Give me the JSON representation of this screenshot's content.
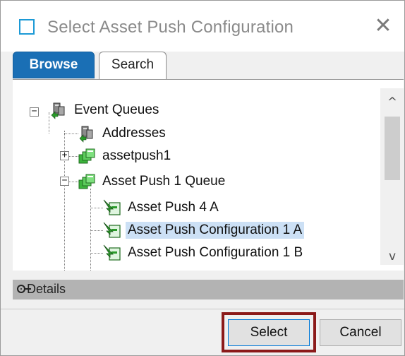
{
  "dialog": {
    "title": "Select Asset Push Configuration",
    "close_glyph": "✕"
  },
  "tabs": [
    {
      "label": "Browse",
      "active": true
    },
    {
      "label": "Search",
      "active": false
    }
  ],
  "tree": {
    "nodes": [
      {
        "label": "Event Queues",
        "icon": "event-queue-icon",
        "expander": "−"
      },
      {
        "label": "Addresses",
        "icon": "event-queue-icon"
      },
      {
        "label": "assetpush1",
        "icon": "queue-stack-icon",
        "expander": "+"
      },
      {
        "label": "Asset Push 1 Queue",
        "icon": "queue-stack-icon",
        "expander": "−"
      },
      {
        "label": "Asset Push 4 A",
        "icon": "push-config-icon"
      },
      {
        "label": "Asset Push Configuration 1 A",
        "icon": "push-config-icon",
        "selected": true
      },
      {
        "label": "Asset Push Configuration 1 B",
        "icon": "push-config-icon"
      }
    ]
  },
  "scrollbar": {
    "up_glyph": "^",
    "down_glyph": "v"
  },
  "details": {
    "label": "Details"
  },
  "buttons": {
    "select": "Select",
    "cancel": "Cancel"
  },
  "colors": {
    "accent": "#1a6fb5",
    "selection": "#cce0f5",
    "highlight_border": "#8b1a1a",
    "details_bar": "#b3b3b3"
  }
}
